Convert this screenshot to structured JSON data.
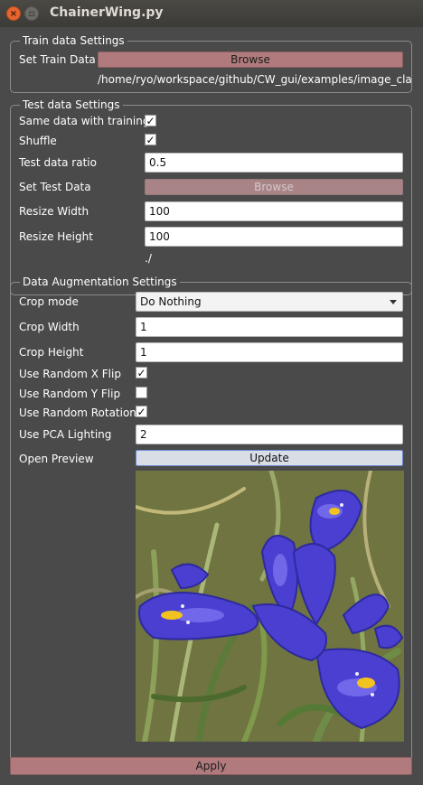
{
  "window": {
    "title": "ChainerWing.py",
    "close_glyph": "×",
    "max_glyph": "▫"
  },
  "train": {
    "group_title": "Train data Settings",
    "set_label": "Set Train Data",
    "browse": "Browse",
    "path": "/home/ryo/workspace/github/CW_gui/examples/image_cla"
  },
  "test": {
    "group_title": "Test data Settings",
    "same_label": "Same data with training",
    "same_checked": "✓",
    "shuffle_label": "Shuffle",
    "shuffle_checked": "✓",
    "ratio_label": "Test data ratio",
    "ratio_value": "0.5",
    "set_label": "Set Test Data",
    "browse": "Browse",
    "resize_w_label": "Resize Width",
    "resize_w_value": "100",
    "resize_h_label": "Resize Height",
    "resize_h_value": "100",
    "path": "./"
  },
  "aug": {
    "group_title": "Data Augmentation Settings",
    "crop_mode_label": "Crop mode",
    "crop_mode_value": "Do Nothing",
    "crop_w_label": "Crop Width",
    "crop_w_value": "1",
    "crop_h_label": "Crop Height",
    "crop_h_value": "1",
    "xflip_label": "Use Random X Flip",
    "xflip_checked": "✓",
    "yflip_label": "Use Random Y Flip",
    "yflip_checked": "",
    "rotation_label": "Use Random Rotation",
    "rotation_checked": "✓",
    "pca_label": "Use PCA Lighting",
    "pca_value": "2",
    "preview_label": "Open Preview",
    "update": "Update"
  },
  "apply": "Apply",
  "colors": {
    "button": "#b17b7e",
    "window_bg": "#4a4a4a",
    "flower_petal": "#4a3fd0",
    "grass": "#5e6a3a"
  }
}
